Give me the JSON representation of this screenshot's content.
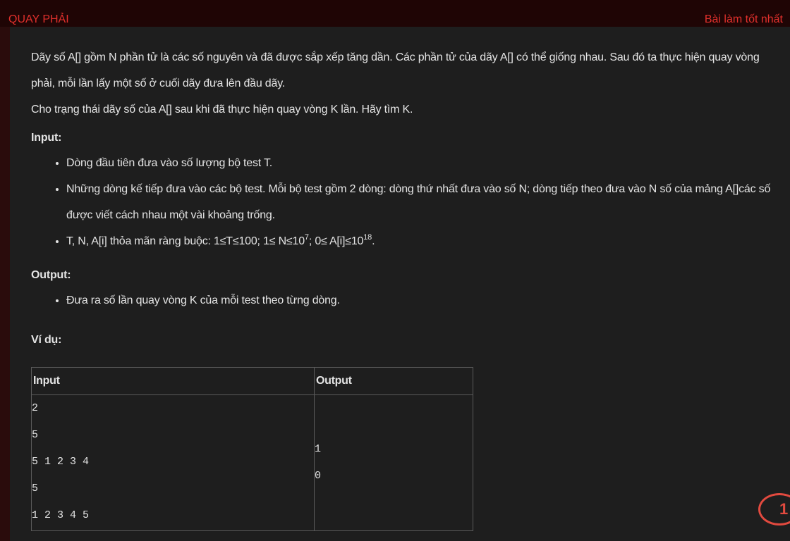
{
  "header": {
    "title": "QUAY PHẢI",
    "best_link": "Bài làm tốt nhất"
  },
  "problem": {
    "para1": "Dãy số A[] gồm N phần tử là các số nguyên và đã được sắp xếp tăng dần. Các phần tử của dãy A[] có thể giống nhau. Sau đó ta thực hiện quay vòng phải, mỗi lần lấy một số ở cuối dãy đưa lên đầu dãy.",
    "para2": "Cho trạng thái dãy số của A[] sau khi đã thực hiện quay vòng K lần. Hãy tìm K.",
    "input_heading": "Input:",
    "input_items": [
      "Dòng đầu tiên đưa vào số lượng bộ test T.",
      "Những dòng kế tiếp đưa vào các bộ test. Mỗi bộ test gồm 2 dòng: dòng thứ nhất đưa vào số N; dòng tiếp theo đưa vào N số của mảng A[]các số được viết cách nhau một vài khoảng trống."
    ],
    "constraint": {
      "prefix": "T, N, A[i] thỏa mãn ràng buộc: 1≤T≤100;  1≤ N≤10",
      "exp1": "7",
      "middle": "; 0≤ A[i]≤10",
      "exp2": "18",
      "suffix": "."
    },
    "output_heading": "Output:",
    "output_items": [
      "Đưa ra số lần quay vòng K của mỗi test theo từng dòng."
    ],
    "example_heading": "Ví dụ:"
  },
  "example_table": {
    "headers": [
      "Input",
      "Output"
    ],
    "input_lines": [
      "2",
      "5",
      "5 1 2 3 4",
      "5",
      "1 2 3 4 5"
    ],
    "output_lines": [
      "1",
      "0"
    ]
  },
  "badge": {
    "count": "1"
  },
  "colors": {
    "accent": "#e0302c",
    "background": "#1e1e1e",
    "frame": "#2a0c0c"
  }
}
